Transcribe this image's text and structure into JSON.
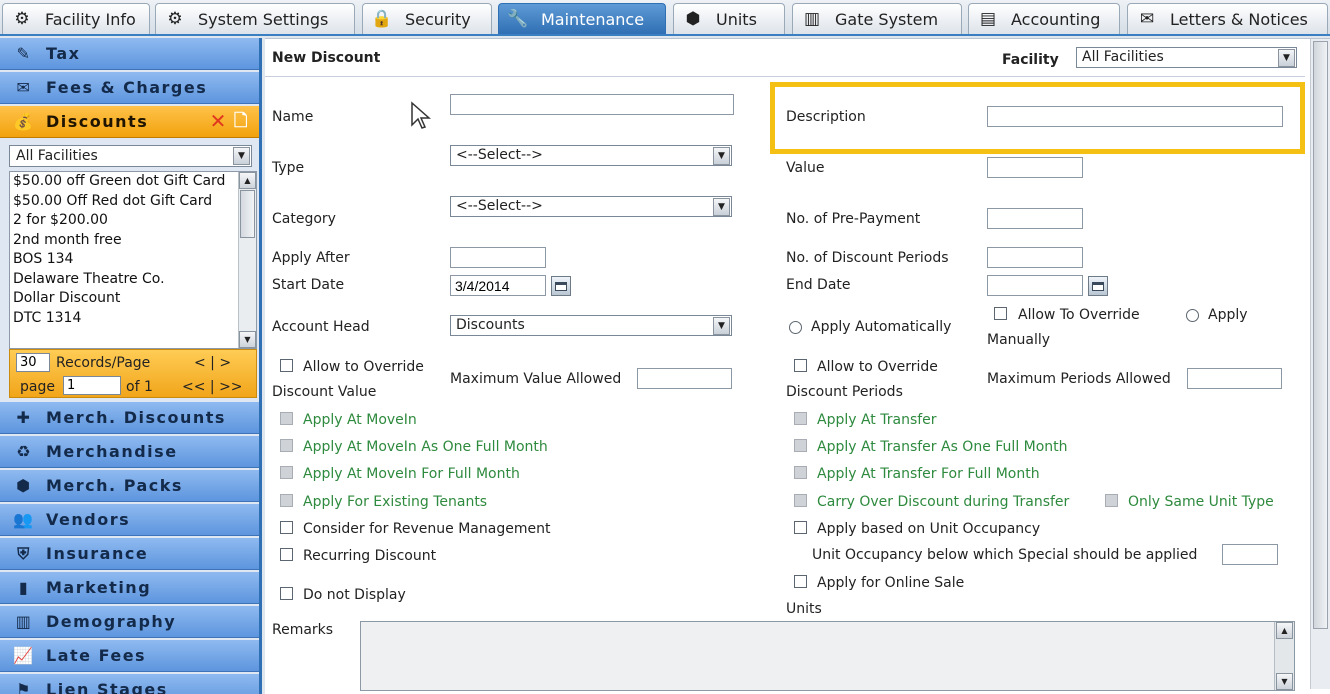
{
  "tabs": [
    {
      "label": "Facility Info",
      "icon": "facility-icon"
    },
    {
      "label": "System Settings",
      "icon": "settings-icon"
    },
    {
      "label": "Security",
      "icon": "security-icon"
    },
    {
      "label": "Maintenance",
      "icon": "maintenance-icon",
      "active": true
    },
    {
      "label": "Units",
      "icon": "units-icon"
    },
    {
      "label": "Gate System",
      "icon": "gate-icon"
    },
    {
      "label": "Accounting",
      "icon": "accounting-icon"
    },
    {
      "label": "Letters & Notices",
      "icon": "letters-icon"
    }
  ],
  "sidebar": {
    "sections_top": [
      {
        "label": "Tax"
      },
      {
        "label": "Fees & Charges"
      },
      {
        "label": "Discounts",
        "active": true
      }
    ],
    "facility_select": "All Facilities",
    "discounts": [
      "$50.00 off Green dot Gift Card",
      "$50.00 Off Red dot Gift Card",
      "2 for $200.00",
      "2nd month free",
      "BOS 134",
      "Delaware Theatre Co.",
      "Dollar Discount",
      "DTC 1314"
    ],
    "pager": {
      "records_per_page": "30",
      "records_label": "Records/Page",
      "first_prev_next": "< | >",
      "page_label": "page",
      "page_value": "1",
      "of_label": "of 1",
      "nav2": "<< | >>"
    },
    "sections_bottom": [
      {
        "label": "Merch. Discounts"
      },
      {
        "label": "Merchandise"
      },
      {
        "label": "Merch. Packs"
      },
      {
        "label": "Vendors"
      },
      {
        "label": "Insurance"
      },
      {
        "label": "Marketing"
      },
      {
        "label": "Demography"
      },
      {
        "label": "Late Fees"
      },
      {
        "label": "Lien Stages"
      }
    ]
  },
  "form": {
    "title": "New Discount",
    "facility_label": "Facility",
    "facility_value": "All Facilities",
    "name_label": "Name",
    "name_value": "",
    "description_label": "Description",
    "description_value": "",
    "type_label": "Type",
    "type_value": "<--Select-->",
    "value_label": "Value",
    "value_value": "",
    "category_label": "Category",
    "category_value": "<--Select-->",
    "prepayment_label": "No. of Pre-Payment",
    "prepayment_value": "",
    "apply_after_label": "Apply After",
    "apply_after_value": "",
    "discount_periods_label": "No. of Discount Periods",
    "discount_periods_value": "",
    "start_date_label": "Start Date",
    "start_date_value": "3/4/2014",
    "end_date_label": "End Date",
    "end_date_value": "",
    "account_head_label": "Account Head",
    "account_head_value": "Discounts",
    "apply_automatically_label": "Apply Automatically",
    "allow_to_override_label": "Allow To Override",
    "apply_label": "Apply",
    "manually_label": "Manually",
    "allow_override_value_label": "Allow to Override",
    "discount_value_label": "Discount Value",
    "max_value_allowed_label": "Maximum Value Allowed",
    "max_value_allowed_value": "",
    "allow_override_periods_label": "Allow to Override",
    "discount_periods_sub_label": "Discount Periods",
    "max_periods_allowed_label": "Maximum Periods Allowed",
    "max_periods_allowed_value": "",
    "left_checks": [
      "Apply At MoveIn",
      "Apply At MoveIn As One Full Month",
      "Apply At MoveIn For Full Month",
      "Apply For Existing Tenants",
      "Consider for Revenue Management",
      "Recurring Discount",
      "Do not Display"
    ],
    "right_checks": [
      "Apply At Transfer",
      "Apply At Transfer As One Full Month",
      "Apply At Transfer For Full Month",
      "Carry Over Discount during Transfer",
      "Only Same Unit Type",
      "Apply based on Unit Occupancy",
      "Apply for Online Sale"
    ],
    "unit_occupancy_label": "Unit Occupancy below which Special should be applied",
    "unit_occupancy_value": "",
    "units_label": "Units",
    "remarks_label": "Remarks",
    "remarks_value": ""
  },
  "colors": {
    "active_tab": "#3a7fc1",
    "active_section": "#f2a20d",
    "highlight": "#f5c014",
    "green_option": "#2e8a3e"
  }
}
